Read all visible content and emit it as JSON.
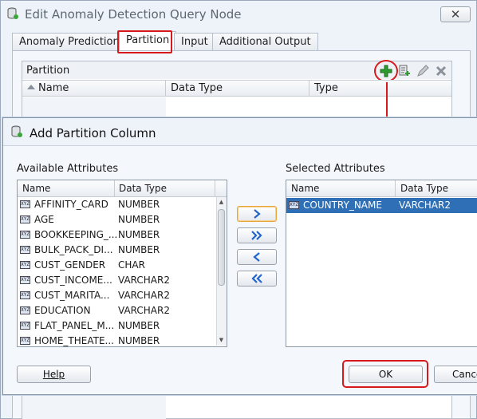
{
  "background_dialog": {
    "title": "Edit Anomaly Detection Query Node",
    "close_label": "✕",
    "tabs": [
      "Anomaly Predictions",
      "Partition",
      "Input",
      "Additional Output"
    ],
    "selected_tab": "Partition",
    "partition": {
      "label": "Partition",
      "columns": [
        "Name",
        "Data Type",
        "Type"
      ],
      "toolbar_icons": [
        "add-icon",
        "add-from-list-icon",
        "edit-icon",
        "delete-icon"
      ]
    }
  },
  "dialog": {
    "title": "Add Partition Column",
    "available": {
      "label": "Available Attributes",
      "columns": [
        "Name",
        "Data Type"
      ],
      "rows": [
        {
          "name": "AFFINITY_CARD",
          "type": "NUMBER"
        },
        {
          "name": "AGE",
          "type": "NUMBER"
        },
        {
          "name": "BOOKKEEPING_...",
          "type": "NUMBER"
        },
        {
          "name": "BULK_PACK_DI...",
          "type": "NUMBER"
        },
        {
          "name": "CUST_GENDER",
          "type": "CHAR"
        },
        {
          "name": "CUST_INCOME...",
          "type": "VARCHAR2"
        },
        {
          "name": "CUST_MARITA...",
          "type": "VARCHAR2"
        },
        {
          "name": "EDUCATION",
          "type": "VARCHAR2"
        },
        {
          "name": "FLAT_PANEL_M...",
          "type": "NUMBER"
        },
        {
          "name": "HOME_THEATE...",
          "type": "NUMBER"
        }
      ]
    },
    "selected": {
      "label": "Selected Attributes",
      "columns": [
        "Name",
        "Data Type"
      ],
      "rows": [
        {
          "name": "COUNTRY_NAME",
          "type": "VARCHAR2"
        }
      ]
    },
    "move_buttons": [
      "move-right-icon",
      "move-all-right-icon",
      "move-left-icon",
      "move-all-left-icon"
    ],
    "help_label": "Help",
    "ok_label": "OK",
    "cancel_label": "Cance"
  },
  "colors": {
    "highlight": "#d7191c",
    "selection": "#2f6fb5",
    "add_green": "#2e9b2e",
    "move_blue": "#2266cc"
  }
}
